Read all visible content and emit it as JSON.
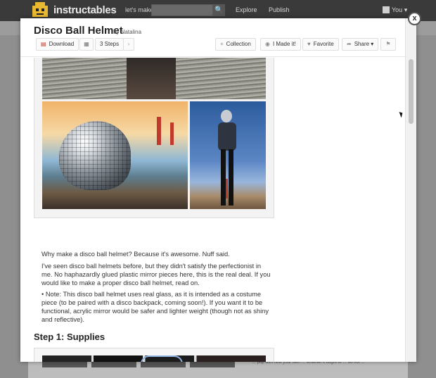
{
  "site": {
    "brand": "instructables",
    "lets_make": "let's make",
    "search_button": "🔍",
    "nav": [
      "Explore",
      "Publish"
    ],
    "user": "You ▾"
  },
  "modal": {
    "close": "x",
    "title": "Disco Ball Helmet",
    "by": "by",
    "author": "Natalina",
    "toolbar": {
      "download": "Download",
      "steps": "3 Steps",
      "next": "›",
      "collection": "Collection",
      "made_it": "I Made it!",
      "favorite": "Favorite",
      "share": "Share ▾",
      "flag": "⚑"
    }
  },
  "intro": {
    "p1": "Why make a disco ball helmet? Because it's awesome. Nuff said.",
    "p2": "I've seen disco ball helmets before, but they didn't satisfy the perfectionist in me. No haphazardly glued plastic mirror pieces here, this is the real deal. If you would like to make a proper disco ball helmet, read on.",
    "p3": "• Note: This disco ball helmet uses real glass, as it is intended as a costume piece (to be paired with a disco backpack, coming soon!). If you want it to be functional, acrylic mirror would be safer and lighter weight (though not as shiny and reflective)."
  },
  "step1": {
    "heading": "Step 1: Supplies"
  },
  "background": {
    "snippet": "… pop with how your own … whether it ought to … do not …"
  },
  "colors": {
    "accent": "#c0392b",
    "rail": "#cfdde8"
  }
}
